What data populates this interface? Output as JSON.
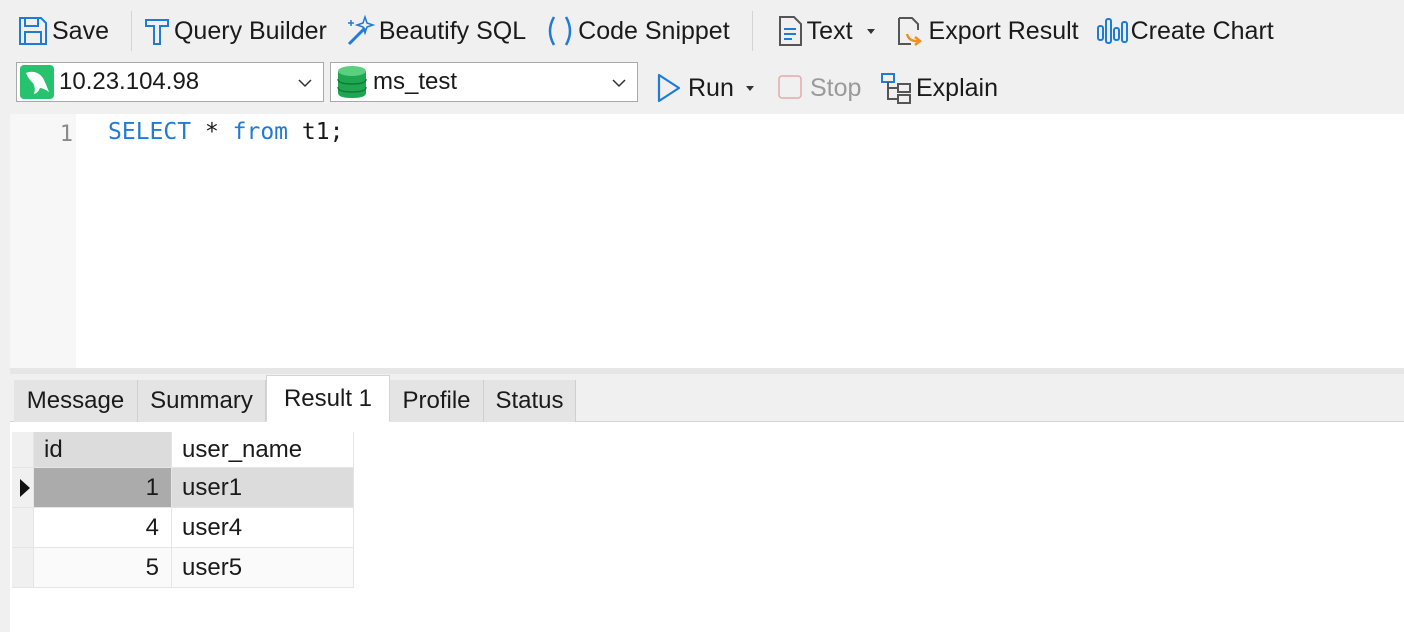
{
  "toolbar": {
    "save": "Save",
    "query_builder": "Query Builder",
    "beautify_sql": "Beautify SQL",
    "code_snippet": "Code Snippet",
    "text": "Text",
    "export_result": "Export Result",
    "create_chart": "Create Chart"
  },
  "connection": {
    "host": "10.23.104.98",
    "database": "ms_test",
    "icon": "dolphin-icon"
  },
  "actions": {
    "run": "Run",
    "stop": "Stop",
    "explain": "Explain"
  },
  "editor": {
    "line_number": "1",
    "kw_select": "SELECT",
    "star": " * ",
    "kw_from": "from",
    "rest": " t1;"
  },
  "tabs": [
    {
      "label": "Message"
    },
    {
      "label": "Summary"
    },
    {
      "label": "Result 1"
    },
    {
      "label": "Profile"
    },
    {
      "label": "Status"
    }
  ],
  "active_tab": "Result 1",
  "grid": {
    "columns": [
      "id",
      "user_name"
    ],
    "rows": [
      [
        "1",
        "user1"
      ],
      [
        "4",
        "user4"
      ],
      [
        "5",
        "user5"
      ]
    ]
  },
  "colors": {
    "accent": "#1e7bd7",
    "keyword": "#1e7bd7",
    "connection_green": "#27c26e",
    "selected_row": "#dcdcdc"
  }
}
